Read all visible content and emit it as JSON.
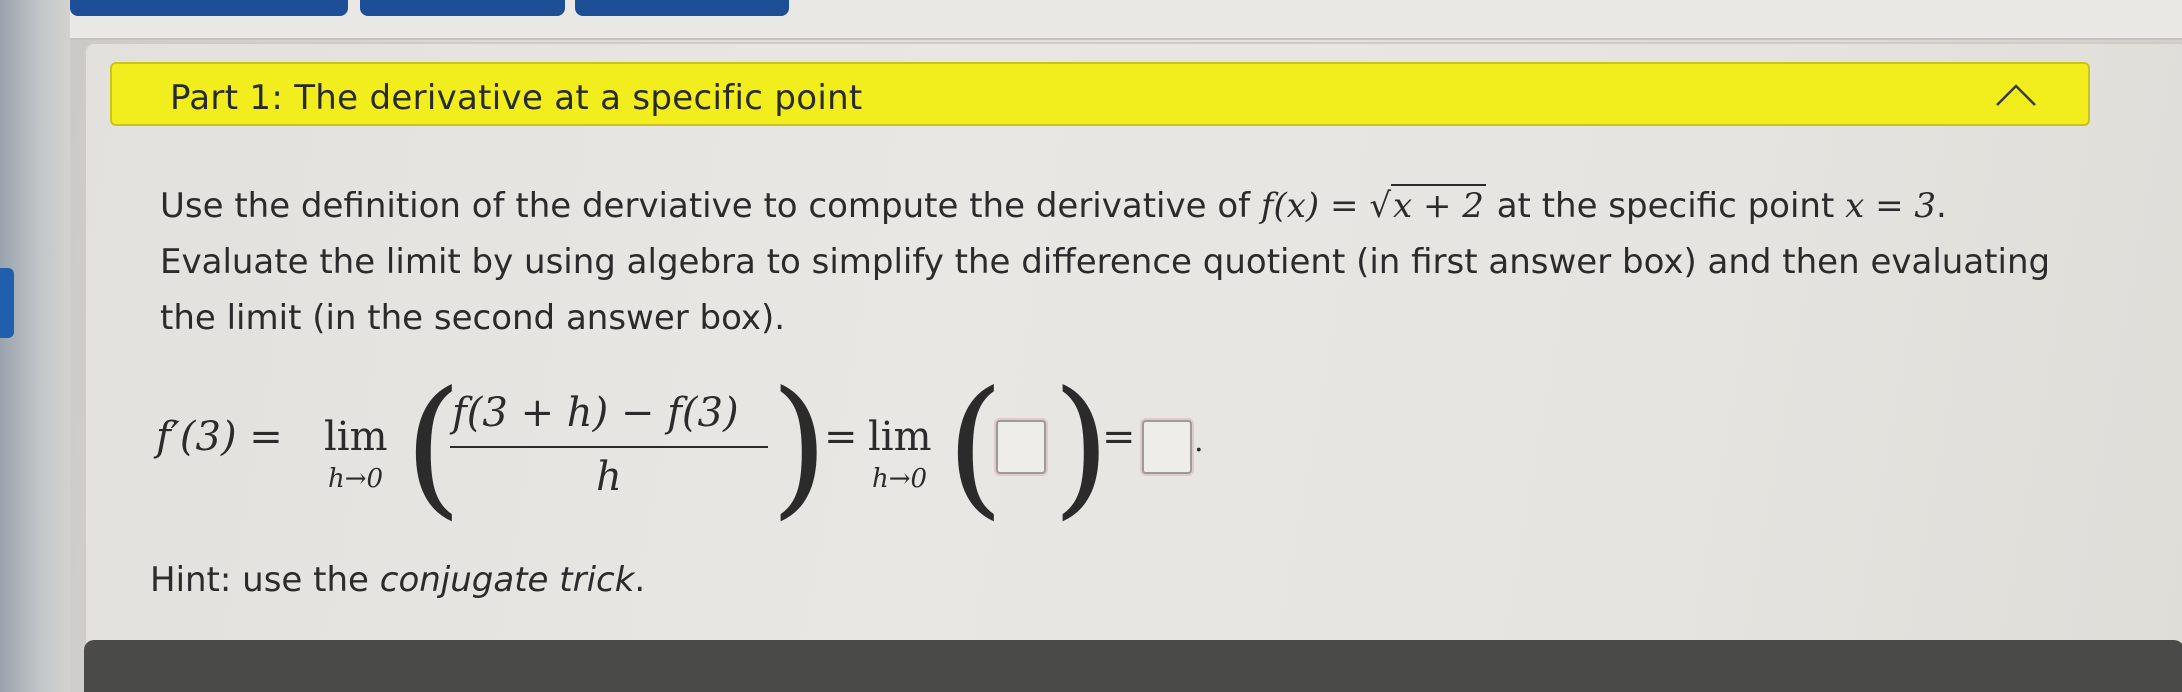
{
  "header": {
    "title": "Part 1: The derivative at a specific point"
  },
  "prompt": {
    "line1_start": "Use the definition of the derviative to compute the derivative of ",
    "fx": "f(x)",
    "equals": " = ",
    "sqrt_expr": "x + 2",
    "line1_mid": " at the specific point ",
    "point": "x = 3",
    "line1_end": ".",
    "line2": "Evaluate the limit by using algebra to simplify the difference quotient (in first answer box) and then evaluating",
    "line3": "the limit (in the second answer box)."
  },
  "equation": {
    "lhs": "f′(3) =",
    "lim1": "lim",
    "lim1_sub": "h→0",
    "numerator": "f(3 + h) − f(3)",
    "denominator": "h",
    "equals2": "=",
    "lim2": "lim",
    "lim2_sub": "h→0",
    "equals3": "=",
    "period": "."
  },
  "answers": {
    "box1_value": "",
    "box2_value": ""
  },
  "hint": {
    "prefix": "Hint: use the ",
    "emphasis": "conjugate trick",
    "suffix": "."
  },
  "colors": {
    "header_bg": "#f2ed1c",
    "nav_blue": "#1d4f97"
  }
}
